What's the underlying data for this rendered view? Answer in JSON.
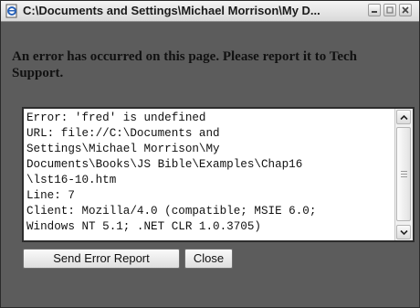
{
  "window": {
    "title": "C:\\Documents and Settings\\Michael Morrison\\My D..."
  },
  "message": "An error has occurred on this page. Please report it to Tech Support.",
  "details": {
    "text": "Error: 'fred' is undefined\nURL: file://C:\\Documents and\nSettings\\Michael Morrison\\My\nDocuments\\Books\\JS Bible\\Examples\\Chap16\n\\lst16-10.htm\nLine: 7\nClient: Mozilla/4.0 (compatible; MSIE 6.0;\nWindows NT 5.1; .NET CLR 1.0.3705)"
  },
  "buttons": {
    "send_report": "Send Error Report",
    "close": "Close"
  },
  "icons": {
    "app": "ie-page-icon",
    "minimize": "minimize-icon",
    "maximize": "maximize-icon",
    "close": "close-icon",
    "scroll_up": "chevron-up-icon",
    "scroll_down": "chevron-down-icon"
  }
}
